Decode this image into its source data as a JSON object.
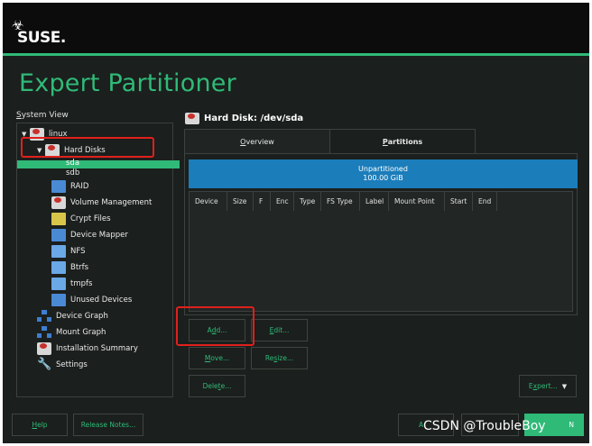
{
  "brand": {
    "logo_text": "SUSE."
  },
  "page": {
    "title": "Expert Partitioner"
  },
  "system_view": {
    "label_prefix": "S",
    "label_rest": "ystem View",
    "tree": [
      {
        "label": "linux",
        "icon": "hard-disk-icon"
      },
      {
        "label": "Hard Disks",
        "icon": "hard-disk-icon"
      },
      {
        "label": "sda",
        "selected": true
      },
      {
        "label": "sdb"
      },
      {
        "label": "RAID",
        "icon": "raid-icon"
      },
      {
        "label": "Volume Management",
        "icon": "volume-management-icon"
      },
      {
        "label": "Crypt Files",
        "icon": "crypt-files-icon"
      },
      {
        "label": "Device Mapper",
        "icon": "device-mapper-icon"
      },
      {
        "label": "NFS",
        "icon": "nfs-folder-icon"
      },
      {
        "label": "Btrfs",
        "icon": "btrfs-folder-icon"
      },
      {
        "label": "tmpfs",
        "icon": "tmpfs-folder-icon"
      },
      {
        "label": "Unused Devices",
        "icon": "unused-devices-icon"
      },
      {
        "label": "Device Graph",
        "icon": "device-graph-icon"
      },
      {
        "label": "Mount Graph",
        "icon": "mount-graph-icon"
      },
      {
        "label": "Installation Summary",
        "icon": "installation-summary-icon"
      },
      {
        "label": "Settings",
        "icon": "wrench-icon"
      }
    ]
  },
  "main": {
    "heading": "Hard Disk: /dev/sda",
    "tabs": [
      {
        "mnemonic": "O",
        "rest": "verview",
        "active": false
      },
      {
        "mnemonic": "P",
        "rest": "artitions",
        "active": true
      }
    ],
    "unpartitioned": {
      "label": "Unpartitioned",
      "size": "100.00 GiB"
    },
    "columns": [
      "Device",
      "Size",
      "F",
      "Enc",
      "Type",
      "FS Type",
      "Label",
      "Mount Point",
      "Start",
      "End"
    ],
    "buttons": {
      "add": {
        "pre": "A",
        "mn": "d",
        "post": "d..."
      },
      "edit": {
        "pre": "",
        "mn": "E",
        "post": "dit..."
      },
      "move": {
        "pre": "",
        "mn": "M",
        "post": "ove..."
      },
      "resize": {
        "pre": "Re",
        "mn": "s",
        "post": "ize..."
      },
      "delete": {
        "pre": "Dele",
        "mn": "t",
        "post": "e..."
      },
      "expert": {
        "pre": "E",
        "mn": "x",
        "post": "pert..."
      }
    }
  },
  "footer": {
    "help": {
      "mn": "H",
      "post": "elp"
    },
    "release_notes": "Release Notes...",
    "abort_partial": "A",
    "next_partial": "N"
  },
  "watermark": "CSDN @TroubleBoy",
  "colors": {
    "accent": "#30ba78",
    "background": "#1b1f1d",
    "info_bar": "#1b7dba",
    "highlight_box": "#e0201c"
  }
}
